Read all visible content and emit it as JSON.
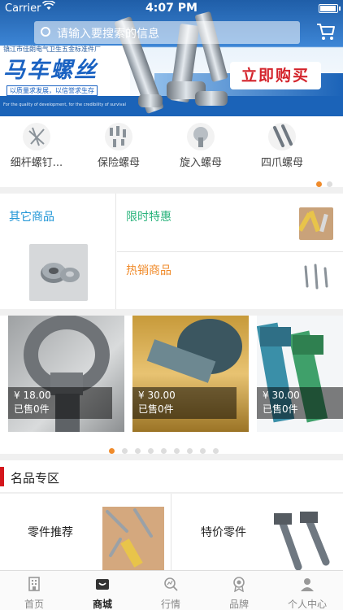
{
  "status_bar": {
    "carrier": "Carrier",
    "time": "4:07 PM"
  },
  "search": {
    "placeholder": "请输入要搜索的信息"
  },
  "banner": {
    "company_line": "镇江市佳朗电气卫生五金标准件厂",
    "title": "马车螺丝",
    "slogan": "以质量求发展，以信誉求生存",
    "english_line": "For the quality of development, for the credibility of survival",
    "buy_button": "立即购买"
  },
  "categories": [
    {
      "label": "细杆螺钉...",
      "icon": "screws-icon"
    },
    {
      "label": "保险螺母",
      "icon": "nuts-icon"
    },
    {
      "label": "旋入螺母",
      "icon": "insert-nut-icon"
    },
    {
      "label": "四爪螺母",
      "icon": "bolts-icon"
    }
  ],
  "promo": {
    "other_goods": "其它商品",
    "limited_offer": "限时特惠",
    "hot_items": "热销商品",
    "colors": {
      "other": "#1f95d6",
      "limited": "#2ab37c",
      "hot": "#f08b2b"
    }
  },
  "products": [
    {
      "price": "¥ 18.00",
      "sold": "已售0件"
    },
    {
      "price": "¥ 30.00",
      "sold": "已售0件"
    },
    {
      "price": "¥ 30.00",
      "sold": "已售0件"
    }
  ],
  "section": {
    "title": "名品专区"
  },
  "featured": [
    {
      "label": "零件推荐"
    },
    {
      "label": "特价零件"
    }
  ],
  "tabs": [
    {
      "label": "首页",
      "icon": "home-icon"
    },
    {
      "label": "商城",
      "icon": "store-icon"
    },
    {
      "label": "行情",
      "icon": "market-icon"
    },
    {
      "label": "品牌",
      "icon": "brand-icon"
    },
    {
      "label": "个人中心",
      "icon": "user-icon"
    }
  ],
  "active_tab": "商城",
  "accent_color": "#f08b2b"
}
